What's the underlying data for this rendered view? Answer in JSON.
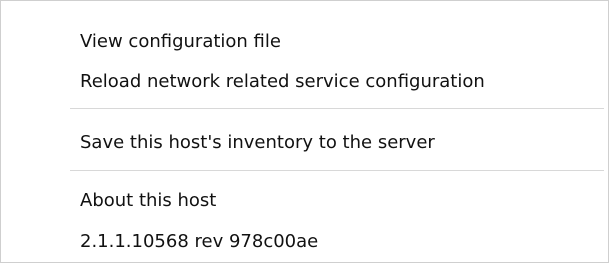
{
  "menu": {
    "items": [
      {
        "label": "View configuration file"
      },
      {
        "label": "Reload network related service configuration"
      },
      {
        "label": "Save this host's inventory to the server"
      },
      {
        "label": "About this host"
      },
      {
        "label": "2.1.1.10568 rev 978c00ae"
      }
    ]
  }
}
